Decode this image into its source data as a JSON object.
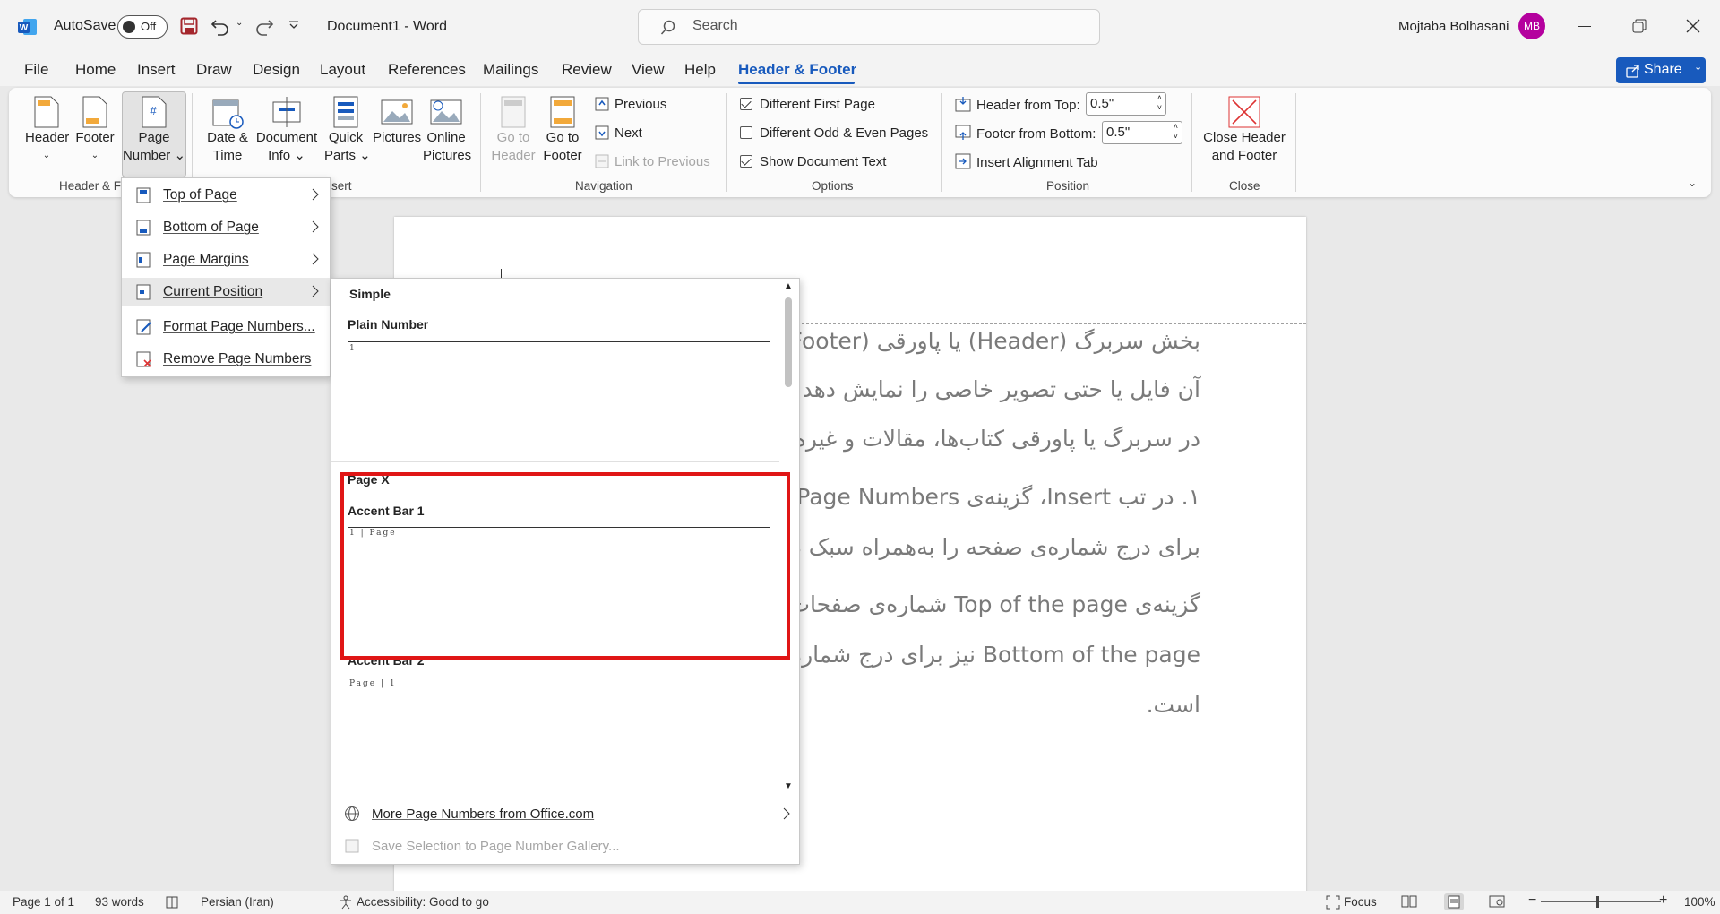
{
  "titlebar": {
    "autosave_label": "AutoSave",
    "autosave_state": "Off",
    "doc_title": "Document1  -  Word",
    "search_placeholder": "Search",
    "user_name": "Mojtaba Bolhasani",
    "user_initials": "MB",
    "share_label": "Share"
  },
  "tabs": [
    "File",
    "Home",
    "Insert",
    "Draw",
    "Design",
    "Layout",
    "References",
    "Mailings",
    "Review",
    "View",
    "Help",
    "Header & Footer"
  ],
  "ribbon": {
    "header": "Header",
    "footer": "Footer",
    "page": "Page",
    "number": "Number",
    "group_hf": "Header & Fo",
    "date": "Date &",
    "time": "Time",
    "document": "Document",
    "info": "Info",
    "quick": "Quick",
    "parts": "Parts",
    "pictures": "Pictures",
    "online": "Online",
    "online2": "Pictures",
    "group_insert": "sert",
    "goto_header1": "Go to",
    "goto_header2": "Header",
    "goto_footer1": "Go to",
    "goto_footer2": "Footer",
    "previous": "Previous",
    "next": "Next",
    "link_prev": "Link to Previous",
    "group_nav": "Navigation",
    "diff_first": "Different First Page",
    "diff_odd": "Different Odd & Even Pages",
    "show_doc": "Show Document Text",
    "group_options": "Options",
    "header_top": "Header from Top:",
    "header_top_val": "0.5\"",
    "footer_bottom": "Footer from Bottom:",
    "footer_bottom_val": "0.5\"",
    "align_tab": "Insert Alignment Tab",
    "group_position": "Position",
    "close1": "Close Header",
    "close2": "and Footer",
    "group_close": "Close"
  },
  "document": {
    "lines": [
      "بخش سربرگ (Header) یا پاورقی (Footer) س",
      "آن فایل یا حتی تصویر خاصی را نمایش دهد. به‌هر",
      "در سربرگ یا پاورقی کتاب‌ها، مقالات و غیره مشاه",
      "۱. در تب Insert، گزینه‌ی Page Numbers را",
      "برای درج شماره‌ی صفحه را به‌همراه سبک ظاهری",
      "گزینه‌ی Top of the page شماره‌ی صفحات را",
      "Bottom of the page نیز برای درج شماره‌ی ص",
      "است."
    ]
  },
  "page_number_menu": [
    "Top of Page",
    "Bottom of Page",
    "Page Margins",
    "Current Position",
    "Format Page Numbers...",
    "Remove Page Numbers"
  ],
  "gallery": {
    "section": "Simple",
    "item1": "Plain Number",
    "item1_preview": "1",
    "section2": "Page X",
    "item2": "Accent Bar 1",
    "item2_preview": "1 | Page",
    "item3": "Accent Bar 2",
    "item3_preview": "Page | 1",
    "more": "More Page Numbers from Office.com",
    "save": "Save Selection to Page Number Gallery..."
  },
  "status": {
    "page": "Page 1 of 1",
    "words": "93 words",
    "lang": "Persian (Iran)",
    "access": "Accessibility: Good to go",
    "focus": "Focus",
    "zoom": "100%"
  }
}
